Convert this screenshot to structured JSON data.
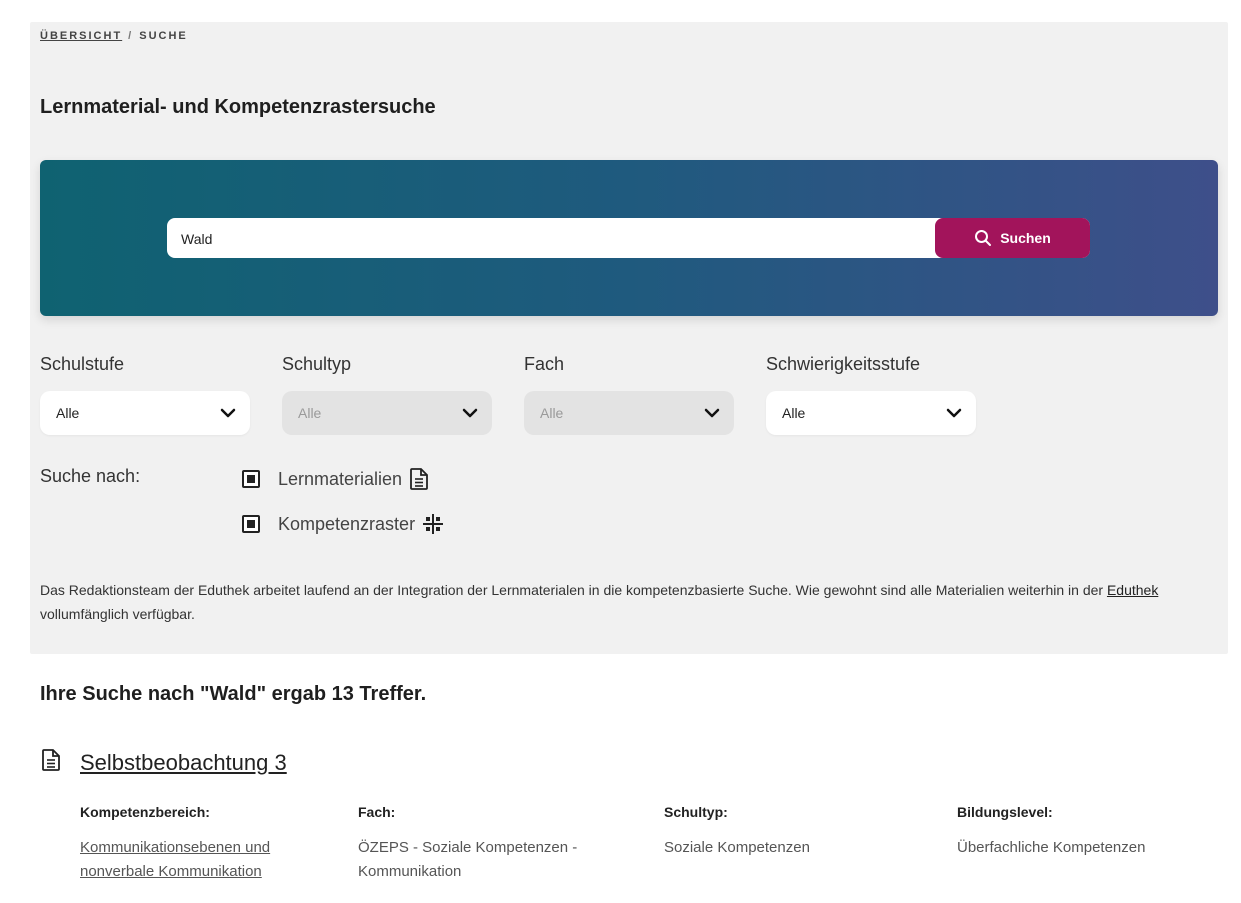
{
  "breadcrumb": {
    "home": "ÜBERSICHT",
    "separator": "/",
    "current": "SUCHE"
  },
  "page_title": "Lernmaterial- und Kompetenzrastersuche",
  "search": {
    "value": "Wald",
    "button_label": "Suchen",
    "button_color": "#a2145b"
  },
  "filters": {
    "schulstufe": {
      "label": "Schulstufe",
      "value": "Alle",
      "enabled": true
    },
    "schultyp": {
      "label": "Schultyp",
      "value": "Alle",
      "enabled": false
    },
    "fach": {
      "label": "Fach",
      "value": "Alle",
      "enabled": false
    },
    "schwierigkeit": {
      "label": "Schwierigkeitsstufe",
      "value": "Alle",
      "enabled": true
    }
  },
  "search_for": {
    "label": "Suche nach:",
    "options": [
      {
        "label": "Lernmaterialien",
        "checked": true,
        "icon": "document-icon"
      },
      {
        "label": "Kompetenzraster",
        "checked": true,
        "icon": "grid-icon"
      }
    ]
  },
  "info": {
    "text_before": "Das Redaktionsteam der Eduthek arbeitet laufend an der Integration der Lernmaterialen in die kompetenzbasierte Suche. Wie gewohnt sind alle Materialien weiterhin in der ",
    "link": "Eduthek",
    "text_after": " vollumfänglich verfügbar."
  },
  "results": {
    "heading": "Ihre Suche nach \"Wald\" ergab 13 Treffer.",
    "items": [
      {
        "title": "Selbstbeobachtung 3",
        "icon": "document-icon",
        "kompetenzbereich_label": "Kompetenzbereich:",
        "kompetenzbereich": "Kommunikationsebenen und nonverbale Kommunikation",
        "fach_label": "Fach:",
        "fach": "ÖZEPS - Soziale Kompetenzen - Kommunikation",
        "schultyp_label": "Schultyp:",
        "schultyp": "Soziale Kompetenzen",
        "bildungslevel_label": "Bildungslevel:",
        "bildungslevel": "Überfachliche Kompetenzen"
      }
    ]
  }
}
